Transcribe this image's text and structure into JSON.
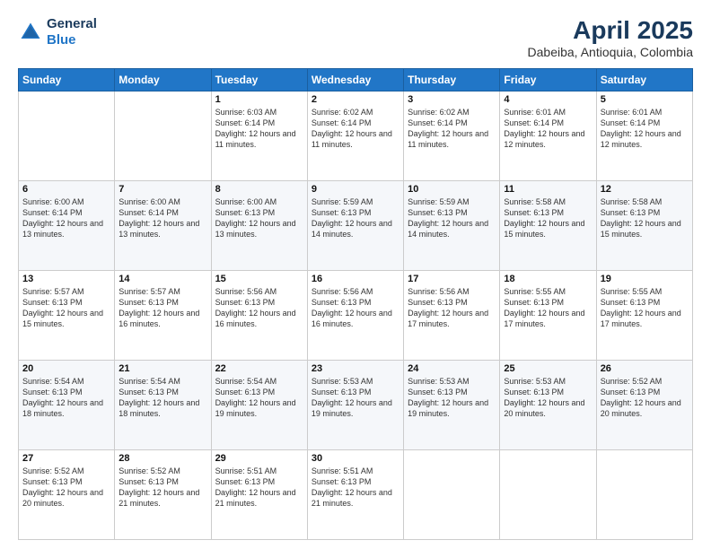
{
  "logo": {
    "general": "General",
    "blue": "Blue"
  },
  "title": "April 2025",
  "subtitle": "Dabeiba, Antioquia, Colombia",
  "days_of_week": [
    "Sunday",
    "Monday",
    "Tuesday",
    "Wednesday",
    "Thursday",
    "Friday",
    "Saturday"
  ],
  "weeks": [
    [
      {
        "day": "",
        "sunrise": "",
        "sunset": "",
        "daylight": ""
      },
      {
        "day": "",
        "sunrise": "",
        "sunset": "",
        "daylight": ""
      },
      {
        "day": "1",
        "sunrise": "Sunrise: 6:03 AM",
        "sunset": "Sunset: 6:14 PM",
        "daylight": "Daylight: 12 hours and 11 minutes."
      },
      {
        "day": "2",
        "sunrise": "Sunrise: 6:02 AM",
        "sunset": "Sunset: 6:14 PM",
        "daylight": "Daylight: 12 hours and 11 minutes."
      },
      {
        "day": "3",
        "sunrise": "Sunrise: 6:02 AM",
        "sunset": "Sunset: 6:14 PM",
        "daylight": "Daylight: 12 hours and 11 minutes."
      },
      {
        "day": "4",
        "sunrise": "Sunrise: 6:01 AM",
        "sunset": "Sunset: 6:14 PM",
        "daylight": "Daylight: 12 hours and 12 minutes."
      },
      {
        "day": "5",
        "sunrise": "Sunrise: 6:01 AM",
        "sunset": "Sunset: 6:14 PM",
        "daylight": "Daylight: 12 hours and 12 minutes."
      }
    ],
    [
      {
        "day": "6",
        "sunrise": "Sunrise: 6:00 AM",
        "sunset": "Sunset: 6:14 PM",
        "daylight": "Daylight: 12 hours and 13 minutes."
      },
      {
        "day": "7",
        "sunrise": "Sunrise: 6:00 AM",
        "sunset": "Sunset: 6:14 PM",
        "daylight": "Daylight: 12 hours and 13 minutes."
      },
      {
        "day": "8",
        "sunrise": "Sunrise: 6:00 AM",
        "sunset": "Sunset: 6:13 PM",
        "daylight": "Daylight: 12 hours and 13 minutes."
      },
      {
        "day": "9",
        "sunrise": "Sunrise: 5:59 AM",
        "sunset": "Sunset: 6:13 PM",
        "daylight": "Daylight: 12 hours and 14 minutes."
      },
      {
        "day": "10",
        "sunrise": "Sunrise: 5:59 AM",
        "sunset": "Sunset: 6:13 PM",
        "daylight": "Daylight: 12 hours and 14 minutes."
      },
      {
        "day": "11",
        "sunrise": "Sunrise: 5:58 AM",
        "sunset": "Sunset: 6:13 PM",
        "daylight": "Daylight: 12 hours and 15 minutes."
      },
      {
        "day": "12",
        "sunrise": "Sunrise: 5:58 AM",
        "sunset": "Sunset: 6:13 PM",
        "daylight": "Daylight: 12 hours and 15 minutes."
      }
    ],
    [
      {
        "day": "13",
        "sunrise": "Sunrise: 5:57 AM",
        "sunset": "Sunset: 6:13 PM",
        "daylight": "Daylight: 12 hours and 15 minutes."
      },
      {
        "day": "14",
        "sunrise": "Sunrise: 5:57 AM",
        "sunset": "Sunset: 6:13 PM",
        "daylight": "Daylight: 12 hours and 16 minutes."
      },
      {
        "day": "15",
        "sunrise": "Sunrise: 5:56 AM",
        "sunset": "Sunset: 6:13 PM",
        "daylight": "Daylight: 12 hours and 16 minutes."
      },
      {
        "day": "16",
        "sunrise": "Sunrise: 5:56 AM",
        "sunset": "Sunset: 6:13 PM",
        "daylight": "Daylight: 12 hours and 16 minutes."
      },
      {
        "day": "17",
        "sunrise": "Sunrise: 5:56 AM",
        "sunset": "Sunset: 6:13 PM",
        "daylight": "Daylight: 12 hours and 17 minutes."
      },
      {
        "day": "18",
        "sunrise": "Sunrise: 5:55 AM",
        "sunset": "Sunset: 6:13 PM",
        "daylight": "Daylight: 12 hours and 17 minutes."
      },
      {
        "day": "19",
        "sunrise": "Sunrise: 5:55 AM",
        "sunset": "Sunset: 6:13 PM",
        "daylight": "Daylight: 12 hours and 17 minutes."
      }
    ],
    [
      {
        "day": "20",
        "sunrise": "Sunrise: 5:54 AM",
        "sunset": "Sunset: 6:13 PM",
        "daylight": "Daylight: 12 hours and 18 minutes."
      },
      {
        "day": "21",
        "sunrise": "Sunrise: 5:54 AM",
        "sunset": "Sunset: 6:13 PM",
        "daylight": "Daylight: 12 hours and 18 minutes."
      },
      {
        "day": "22",
        "sunrise": "Sunrise: 5:54 AM",
        "sunset": "Sunset: 6:13 PM",
        "daylight": "Daylight: 12 hours and 19 minutes."
      },
      {
        "day": "23",
        "sunrise": "Sunrise: 5:53 AM",
        "sunset": "Sunset: 6:13 PM",
        "daylight": "Daylight: 12 hours and 19 minutes."
      },
      {
        "day": "24",
        "sunrise": "Sunrise: 5:53 AM",
        "sunset": "Sunset: 6:13 PM",
        "daylight": "Daylight: 12 hours and 19 minutes."
      },
      {
        "day": "25",
        "sunrise": "Sunrise: 5:53 AM",
        "sunset": "Sunset: 6:13 PM",
        "daylight": "Daylight: 12 hours and 20 minutes."
      },
      {
        "day": "26",
        "sunrise": "Sunrise: 5:52 AM",
        "sunset": "Sunset: 6:13 PM",
        "daylight": "Daylight: 12 hours and 20 minutes."
      }
    ],
    [
      {
        "day": "27",
        "sunrise": "Sunrise: 5:52 AM",
        "sunset": "Sunset: 6:13 PM",
        "daylight": "Daylight: 12 hours and 20 minutes."
      },
      {
        "day": "28",
        "sunrise": "Sunrise: 5:52 AM",
        "sunset": "Sunset: 6:13 PM",
        "daylight": "Daylight: 12 hours and 21 minutes."
      },
      {
        "day": "29",
        "sunrise": "Sunrise: 5:51 AM",
        "sunset": "Sunset: 6:13 PM",
        "daylight": "Daylight: 12 hours and 21 minutes."
      },
      {
        "day": "30",
        "sunrise": "Sunrise: 5:51 AM",
        "sunset": "Sunset: 6:13 PM",
        "daylight": "Daylight: 12 hours and 21 minutes."
      },
      {
        "day": "",
        "sunrise": "",
        "sunset": "",
        "daylight": ""
      },
      {
        "day": "",
        "sunrise": "",
        "sunset": "",
        "daylight": ""
      },
      {
        "day": "",
        "sunrise": "",
        "sunset": "",
        "daylight": ""
      }
    ]
  ]
}
